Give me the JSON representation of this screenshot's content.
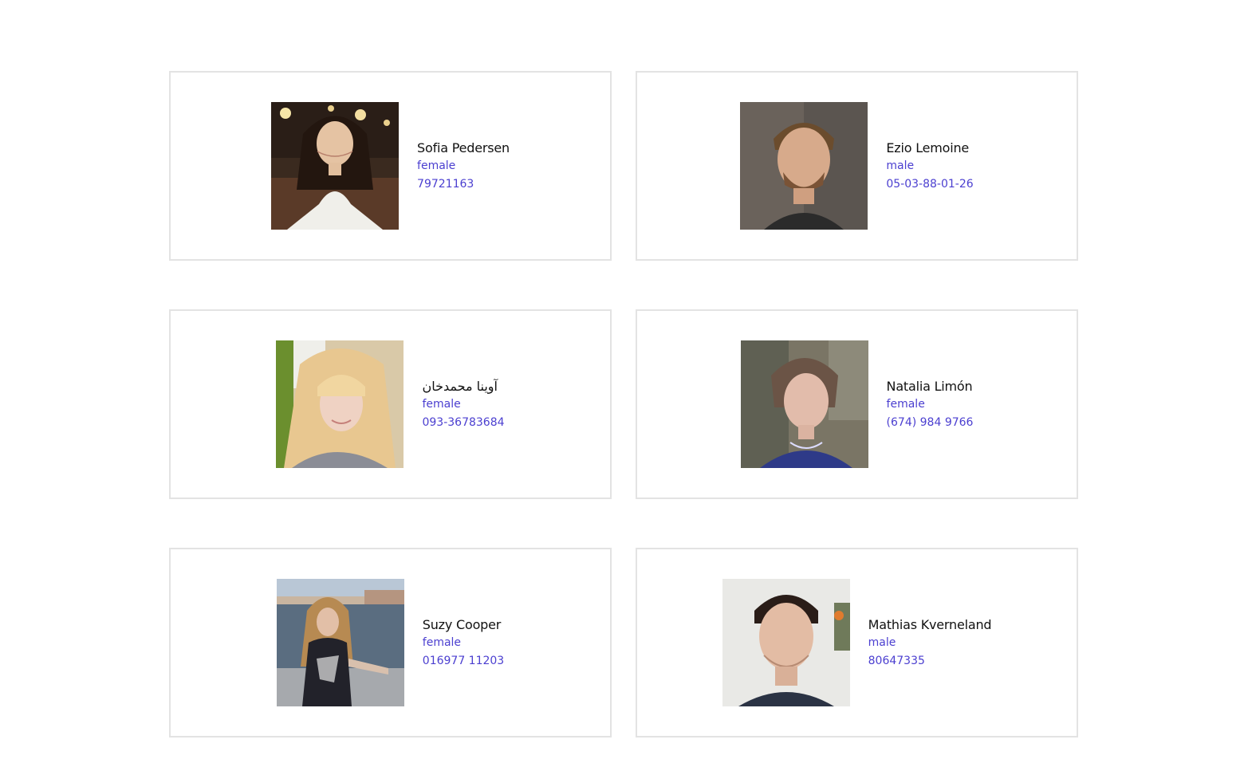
{
  "people": [
    {
      "name": "Sofia Pedersen",
      "gender": "female",
      "phone": "79721163",
      "photo": "smiling-woman-dark-hair-cafe-photo"
    },
    {
      "name": "Ezio Lemoine",
      "gender": "male",
      "phone": "05-03-88-01-26",
      "photo": "man-short-hair-beard-photo"
    },
    {
      "name": "آوینا محمدخان",
      "gender": "female",
      "phone": "093-36783684",
      "photo": "blonde-woman-bangs-photo"
    },
    {
      "name": "Natalia Limón",
      "gender": "female",
      "phone": "(674) 984 9766",
      "photo": "woman-blue-dress-outdoor-photo"
    },
    {
      "name": "Suzy Cooper",
      "gender": "female",
      "phone": "016977 11203",
      "photo": "woman-riverside-city-photo"
    },
    {
      "name": "Mathias Kverneland",
      "gender": "male",
      "phone": "80647335",
      "photo": "man-slicked-hair-portrait-photo"
    }
  ],
  "colors": {
    "link": "#4b3fd0",
    "name": "#111111",
    "card_border": "#e3e3e3"
  }
}
